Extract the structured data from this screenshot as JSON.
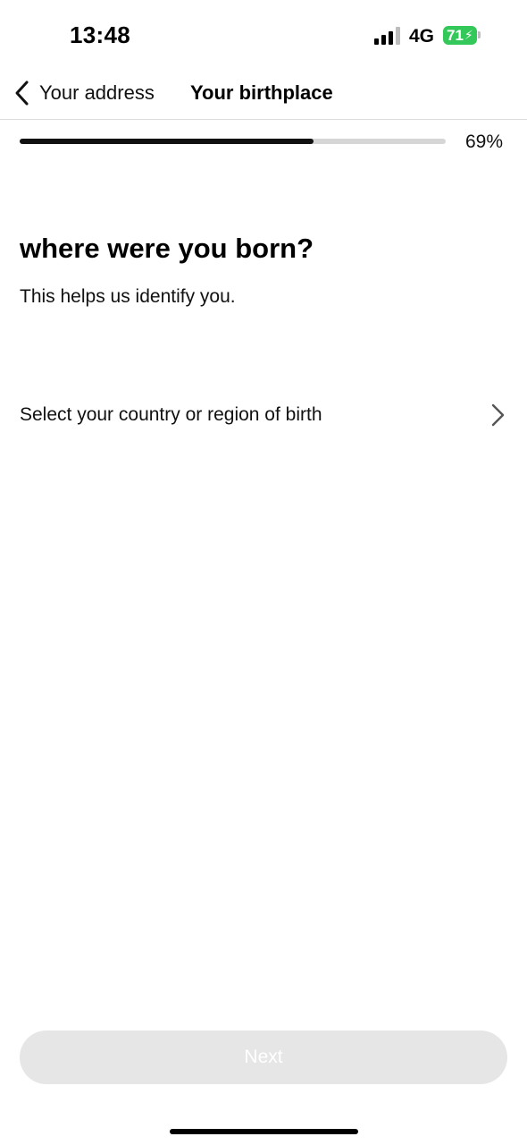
{
  "status_bar": {
    "time": "13:48",
    "network": "4G",
    "battery": "71",
    "signal_bars_active": 3,
    "battery_color": "#34c759"
  },
  "nav": {
    "back_label": "Your address",
    "title": "Your birthplace",
    "back_icon": "chevron-left-icon"
  },
  "progress": {
    "percent_text": "69%",
    "value": 0.69
  },
  "content": {
    "heading": "where were you born?",
    "subtext": "This helps us identify you.",
    "select_label": "Select your country or region of birth",
    "select_icon": "chevron-right-icon"
  },
  "footer": {
    "next_label": "Next",
    "next_bg": "#e6e6e6"
  }
}
